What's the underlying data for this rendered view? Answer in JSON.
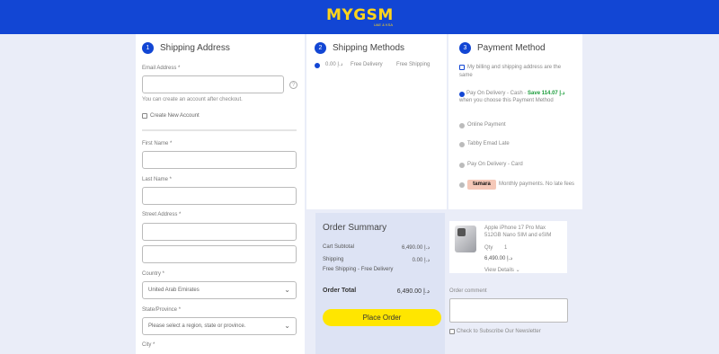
{
  "header": {
    "logo_text": "MYGSM",
    "logo_sub": "UAE & KSA"
  },
  "steps": {
    "shipping": {
      "num": "1",
      "title": "Shipping Address"
    },
    "methods": {
      "num": "2",
      "title": "Shipping Methods"
    },
    "payment": {
      "num": "3",
      "title": "Payment Method"
    }
  },
  "shipping": {
    "email_label": "Email Address *",
    "email_hint": "You can create an account after checkout.",
    "create_account_label": "Create New Account",
    "first_name_label": "First Name *",
    "last_name_label": "Last Name *",
    "street_label": "Street Address *",
    "country_label": "Country *",
    "country_value": "United Arab Emirates",
    "state_label": "State/Province *",
    "state_placeholder": "Please select a region, state or province.",
    "city_label": "City *"
  },
  "shipping_method": {
    "price": "د.إ 0.00",
    "carrier": "Free Delivery",
    "method": "Free Shipping"
  },
  "payment": {
    "billing_same": "My billing and shipping address are the same",
    "cod_cash": "Pay On Delivery - Cash -",
    "cod_cash_promo": "Save د.إ 114.07",
    "cod_cash_note": "when you choose this Payment Method",
    "online": "Online Payment",
    "tabby": "Tabby Emad Late",
    "cod_card": "Pay On Delivery - Card",
    "tamara_badge": "tamara",
    "tamara_text": "Monthly payments. No late fees"
  },
  "summary": {
    "title": "Order Summary",
    "subtotal_label": "Cart Subtotal",
    "subtotal_value": "د.إ 6,490.00",
    "shipping_label": "Shipping",
    "shipping_value": "د.إ 0.00",
    "shipping_note": "Free Shipping - Free Delivery",
    "total_label": "Order Total",
    "total_value": "د.إ 6,490.00",
    "place_order": "Place Order"
  },
  "product": {
    "name": "Apple iPhone 17 Pro Max 512GB Nano SIM and eSIM",
    "qty_label": "Qty",
    "qty_value": "1",
    "price": "د.إ 6,490.00",
    "details_link": "View Details ⌄"
  },
  "comment": {
    "label": "Order comment",
    "newsletter": "Check to Subscribe Our Newsletter"
  }
}
